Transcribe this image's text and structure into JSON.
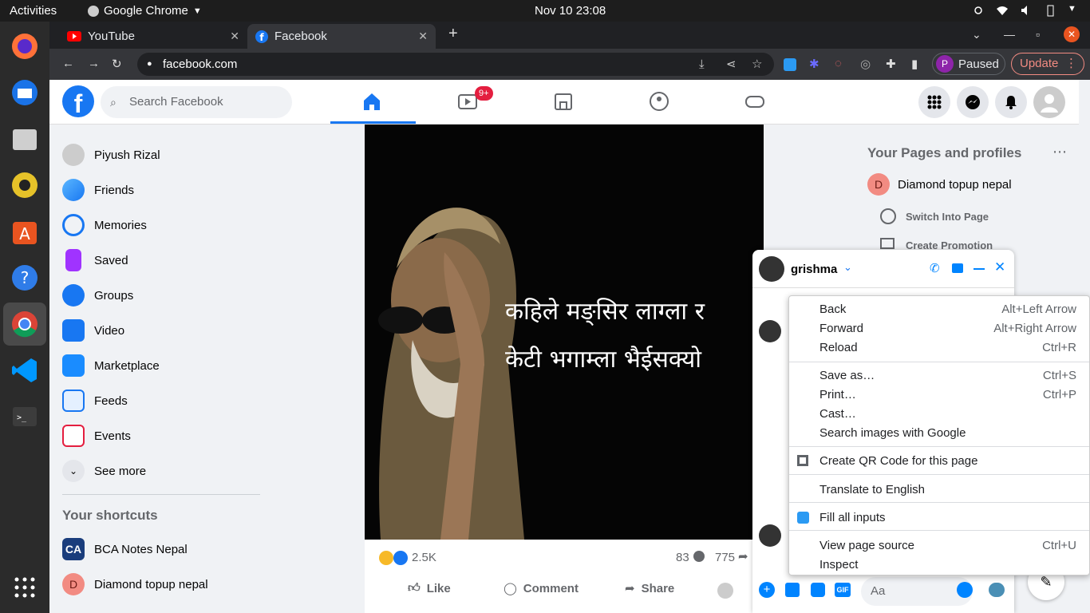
{
  "system": {
    "activities": "Activities",
    "app_menu": "Google Chrome",
    "clock": "Nov 10  23:08"
  },
  "chrome": {
    "tabs": [
      {
        "title": "YouTube"
      },
      {
        "title": "Facebook"
      }
    ],
    "url": "facebook.com",
    "profile_status": "Paused",
    "profile_initial": "P",
    "update_label": "Update"
  },
  "facebook": {
    "search_placeholder": "Search Facebook",
    "watch_badge": "9+",
    "left_nav": [
      {
        "label": "Piyush Rizal"
      },
      {
        "label": "Friends"
      },
      {
        "label": "Memories"
      },
      {
        "label": "Saved"
      },
      {
        "label": "Groups"
      },
      {
        "label": "Video"
      },
      {
        "label": "Marketplace"
      },
      {
        "label": "Feeds"
      },
      {
        "label": "Events"
      },
      {
        "label": "See more"
      }
    ],
    "shortcuts_title": "Your shortcuts",
    "shortcuts": [
      {
        "label": "BCA Notes Nepal"
      },
      {
        "label": "Diamond topup nepal",
        "initial": "D"
      }
    ],
    "post": {
      "text_line1": "कहिले मङ्सिर लाग्ला र",
      "text_line2": "केटी भगाम्ला भैईसक्यो",
      "reactions": "2.5K",
      "comments": "83",
      "shares": "775",
      "like": "Like",
      "comment": "Comment",
      "share": "Share"
    },
    "right": {
      "title": "Your Pages and profiles",
      "page_name": "Diamond topup nepal",
      "page_initial": "D",
      "switch": "Switch Into Page",
      "promotion": "Create Promotion"
    },
    "chat": {
      "name": "grishma",
      "input_placeholder": "Aa"
    }
  },
  "context_menu": [
    {
      "label": "Back",
      "shortcut": "Alt+Left Arrow"
    },
    {
      "label": "Forward",
      "shortcut": "Alt+Right Arrow"
    },
    {
      "label": "Reload",
      "shortcut": "Ctrl+R"
    },
    {
      "label": "Save as…",
      "shortcut": "Ctrl+S"
    },
    {
      "label": "Print…",
      "shortcut": "Ctrl+P"
    },
    {
      "label": "Cast…",
      "shortcut": ""
    },
    {
      "label": "Search images with Google",
      "shortcut": ""
    },
    {
      "label": "Create QR Code for this page",
      "shortcut": ""
    },
    {
      "label": "Translate to English",
      "shortcut": ""
    },
    {
      "label": "Fill all inputs",
      "shortcut": ""
    },
    {
      "label": "View page source",
      "shortcut": "Ctrl+U"
    },
    {
      "label": "Inspect",
      "shortcut": ""
    }
  ],
  "colors": {
    "fb_blue": "#1877f2",
    "badge_red": "#e41e3f",
    "messenger_blue": "#0084ff"
  }
}
